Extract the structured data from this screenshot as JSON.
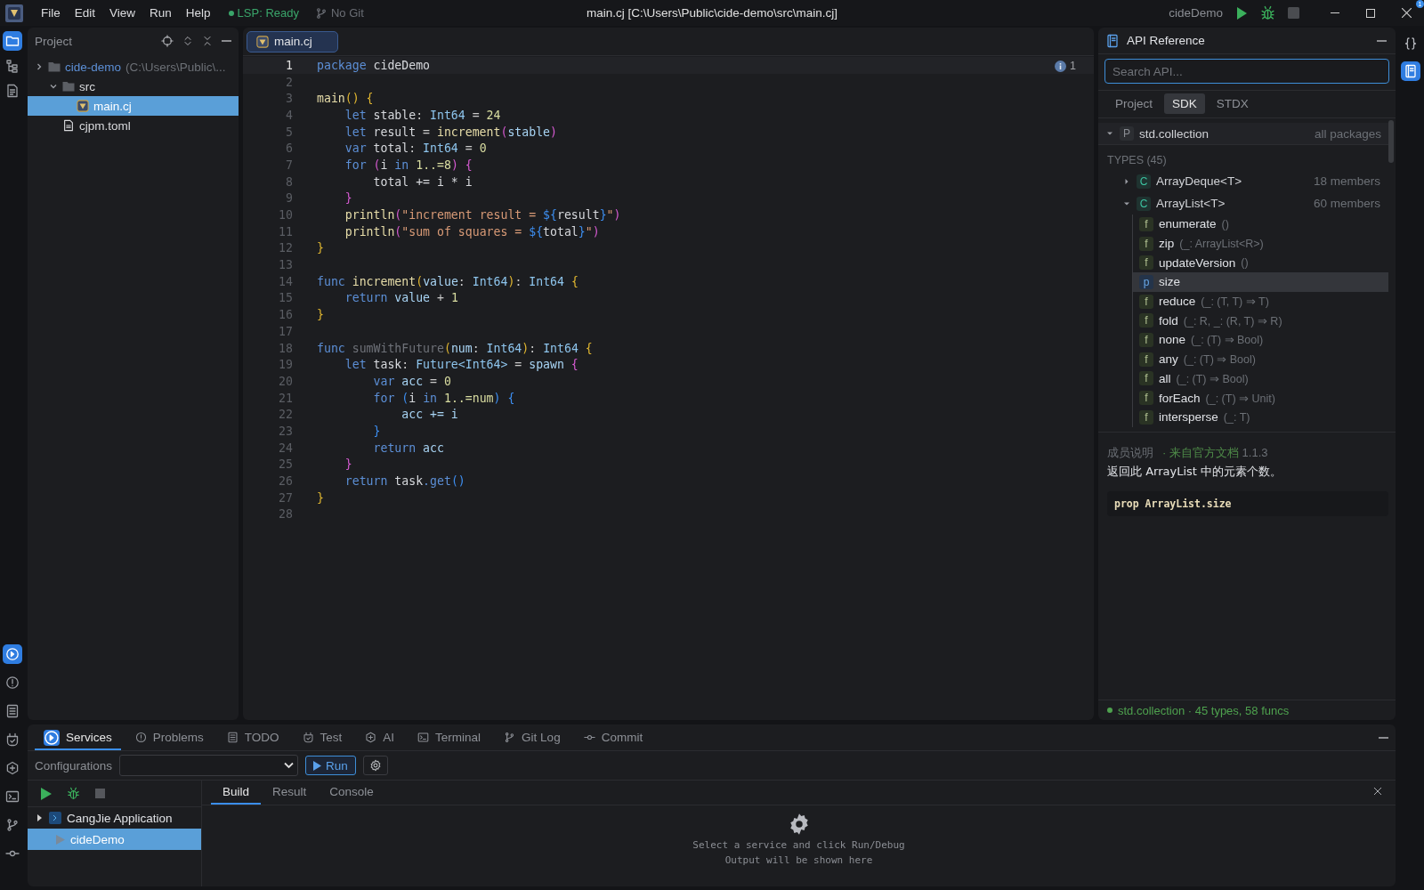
{
  "title_bar": {
    "menu": [
      "File",
      "Edit",
      "View",
      "Run",
      "Help"
    ],
    "lsp_status": "LSP: Ready",
    "git_status": "No Git",
    "title": "main.cj [C:\\Users\\Public\\cide-demo\\src\\main.cj]",
    "run_config": "cideDemo",
    "notification_badge": "1"
  },
  "activity_bar": {
    "top": [
      {
        "kind": "folder",
        "selected": true
      },
      {
        "kind": "structure",
        "selected": false
      },
      {
        "kind": "document",
        "selected": false
      }
    ],
    "bottom": [
      {
        "kind": "services",
        "selected": true
      },
      {
        "kind": "problems",
        "selected": false
      },
      {
        "kind": "todo",
        "selected": false
      },
      {
        "kind": "test",
        "selected": false
      },
      {
        "kind": "ai",
        "selected": false
      },
      {
        "kind": "terminal",
        "selected": false
      },
      {
        "kind": "git",
        "selected": false
      },
      {
        "kind": "commit",
        "selected": false
      }
    ]
  },
  "project": {
    "title": "Project",
    "tree": [
      {
        "name": "cide-demo",
        "path": "(C:\\Users\\Public\\...",
        "kind": "folder",
        "expanded": false,
        "selected": false,
        "children": [
          {
            "name": "src",
            "kind": "folder",
            "expanded": true,
            "selected": false,
            "children": [
              {
                "name": "main.cj",
                "kind": "cj",
                "selected": true
              }
            ]
          },
          {
            "name": "cjpm.toml",
            "kind": "file",
            "selected": false
          }
        ]
      }
    ]
  },
  "editor": {
    "tabs": [
      {
        "label": "main.cj",
        "selected": true
      }
    ],
    "info_count": "1",
    "lines": [
      {
        "number": "1",
        "current": true,
        "tokens": [
          {
            "text": "package",
            "kind": "kw"
          },
          {
            "text": " cideDemo",
            "kind": "id"
          }
        ]
      },
      {
        "number": "2",
        "current": false
      },
      {
        "number": "3",
        "current": false,
        "tokens": [
          {
            "text": "main",
            "kind": "fn"
          },
          {
            "text": "()",
            "kind": "b1"
          },
          {
            "text": " {",
            "kind": "b1"
          }
        ]
      },
      {
        "number": "4",
        "current": false,
        "tokens": [
          {
            "text": "    let",
            "kind": "kw"
          },
          {
            "text": " stable",
            "kind": "id"
          },
          {
            "text": ": ",
            "kind": "op"
          },
          {
            "text": "Int64",
            "kind": "type"
          },
          {
            "text": " = ",
            "kind": "op"
          },
          {
            "text": "24",
            "kind": "num"
          }
        ]
      },
      {
        "number": "5",
        "current": false,
        "tokens": [
          {
            "text": "    let",
            "kind": "kw"
          },
          {
            "text": " result",
            "kind": "id"
          },
          {
            "text": " = ",
            "kind": "op"
          },
          {
            "text": "increment",
            "kind": "fn"
          },
          {
            "text": "(",
            "kind": "b2"
          },
          {
            "text": "stable",
            "kind": "param"
          },
          {
            "text": ")",
            "kind": "b2"
          }
        ]
      },
      {
        "number": "6",
        "current": false,
        "tokens": [
          {
            "text": "    var",
            "kind": "kw"
          },
          {
            "text": " total",
            "kind": "id"
          },
          {
            "text": ": ",
            "kind": "op"
          },
          {
            "text": "Int64",
            "kind": "type"
          },
          {
            "text": " = ",
            "kind": "op"
          },
          {
            "text": "0",
            "kind": "num"
          }
        ]
      },
      {
        "number": "7",
        "current": false,
        "tokens": [
          {
            "text": "    for",
            "kind": "kw"
          },
          {
            "text": " (",
            "kind": "b2"
          },
          {
            "text": "i",
            "kind": "id"
          },
          {
            "text": " in ",
            "kind": "kw"
          },
          {
            "text": "1..=8",
            "kind": "num"
          },
          {
            "text": ")",
            "kind": "b2"
          },
          {
            "text": " {",
            "kind": "b2"
          }
        ]
      },
      {
        "number": "8",
        "current": false,
        "tokens": [
          {
            "text": "        total += i * i",
            "kind": "id"
          }
        ]
      },
      {
        "number": "9",
        "current": false,
        "tokens": [
          {
            "text": "    }",
            "kind": "b2"
          }
        ]
      },
      {
        "number": "10",
        "current": false,
        "tokens": [
          {
            "text": "    println",
            "kind": "fn"
          },
          {
            "text": "(",
            "kind": "b2"
          },
          {
            "text": "\"increment result = ",
            "kind": "str"
          },
          {
            "text": "${",
            "kind": "b3"
          },
          {
            "text": "result",
            "kind": "id"
          },
          {
            "text": "}",
            "kind": "b3"
          },
          {
            "text": "\"",
            "kind": "str"
          },
          {
            "text": ")",
            "kind": "b2"
          }
        ]
      },
      {
        "number": "11",
        "current": false,
        "tokens": [
          {
            "text": "    println",
            "kind": "fn"
          },
          {
            "text": "(",
            "kind": "b2"
          },
          {
            "text": "\"sum of squares = ",
            "kind": "str"
          },
          {
            "text": "${",
            "kind": "b3"
          },
          {
            "text": "total",
            "kind": "id"
          },
          {
            "text": "}",
            "kind": "b3"
          },
          {
            "text": "\"",
            "kind": "str"
          },
          {
            "text": ")",
            "kind": "b2"
          }
        ]
      },
      {
        "number": "12",
        "current": false,
        "tokens": [
          {
            "text": "}",
            "kind": "b1"
          }
        ]
      },
      {
        "number": "13",
        "current": false
      },
      {
        "number": "14",
        "current": false,
        "tokens": [
          {
            "text": "func",
            "kind": "kw"
          },
          {
            "text": " increment",
            "kind": "fn"
          },
          {
            "text": "(",
            "kind": "b1"
          },
          {
            "text": "value",
            "kind": "param"
          },
          {
            "text": ": ",
            "kind": "op"
          },
          {
            "text": "Int64",
            "kind": "type"
          },
          {
            "text": ")",
            "kind": "b1"
          },
          {
            "text": ": ",
            "kind": "op"
          },
          {
            "text": "Int64",
            "kind": "type"
          },
          {
            "text": " {",
            "kind": "b1"
          }
        ]
      },
      {
        "number": "15",
        "current": false,
        "tokens": [
          {
            "text": "    return",
            "kind": "kw"
          },
          {
            "text": " value",
            "kind": "param"
          },
          {
            "text": " + ",
            "kind": "op"
          },
          {
            "text": "1",
            "kind": "num"
          }
        ]
      },
      {
        "number": "16",
        "current": false,
        "tokens": [
          {
            "text": "}",
            "kind": "b1"
          }
        ]
      },
      {
        "number": "17",
        "current": false
      },
      {
        "number": "18",
        "current": false,
        "tokens": [
          {
            "text": "func",
            "kind": "kw"
          },
          {
            "text": " sumWithFuture",
            "kind": "dim"
          },
          {
            "text": "(",
            "kind": "b1"
          },
          {
            "text": "num",
            "kind": "param"
          },
          {
            "text": ": ",
            "kind": "op"
          },
          {
            "text": "Int64",
            "kind": "type"
          },
          {
            "text": ")",
            "kind": "b1"
          },
          {
            "text": ": ",
            "kind": "op"
          },
          {
            "text": "Int64",
            "kind": "type"
          },
          {
            "text": " {",
            "kind": "b1"
          }
        ]
      },
      {
        "number": "19",
        "current": false,
        "tokens": [
          {
            "text": "    let",
            "kind": "kw"
          },
          {
            "text": " task",
            "kind": "id"
          },
          {
            "text": ": ",
            "kind": "op"
          },
          {
            "text": "Future<Int64>",
            "kind": "type"
          },
          {
            "text": " = ",
            "kind": "op"
          },
          {
            "text": "spawn",
            "kind": "param"
          },
          {
            "text": " {",
            "kind": "b2"
          }
        ]
      },
      {
        "number": "20",
        "current": false,
        "tokens": [
          {
            "text": "        var",
            "kind": "kw"
          },
          {
            "text": " acc",
            "kind": "param"
          },
          {
            "text": " = ",
            "kind": "op"
          },
          {
            "text": "0",
            "kind": "num"
          }
        ]
      },
      {
        "number": "21",
        "current": false,
        "tokens": [
          {
            "text": "        for",
            "kind": "kw"
          },
          {
            "text": " (",
            "kind": "b3"
          },
          {
            "text": "i",
            "kind": "id"
          },
          {
            "text": " in ",
            "kind": "kw"
          },
          {
            "text": "1..=num",
            "kind": "num"
          },
          {
            "text": ")",
            "kind": "b3"
          },
          {
            "text": " {",
            "kind": "b3"
          }
        ]
      },
      {
        "number": "22",
        "current": false,
        "tokens": [
          {
            "text": "            acc += i",
            "kind": "param"
          }
        ]
      },
      {
        "number": "23",
        "current": false,
        "tokens": [
          {
            "text": "        }",
            "kind": "b3"
          }
        ]
      },
      {
        "number": "24",
        "current": false,
        "tokens": [
          {
            "text": "        return",
            "kind": "kw"
          },
          {
            "text": " acc",
            "kind": "param"
          }
        ]
      },
      {
        "number": "25",
        "current": false,
        "tokens": [
          {
            "text": "    }",
            "kind": "b2"
          }
        ]
      },
      {
        "number": "26",
        "current": false,
        "tokens": [
          {
            "text": "    return",
            "kind": "kw"
          },
          {
            "text": " task",
            "kind": "id"
          },
          {
            "text": ".get",
            "kind": "method"
          },
          {
            "text": "()",
            "kind": "b3"
          }
        ]
      },
      {
        "number": "27",
        "current": false,
        "tokens": [
          {
            "text": "}",
            "kind": "b1"
          }
        ]
      },
      {
        "number": "28",
        "current": false
      }
    ]
  },
  "api_reference": {
    "title": "API Reference",
    "search": {
      "placeholder": "Search API..."
    },
    "tabs": [
      {
        "label": "Project",
        "selected": false
      },
      {
        "label": "SDK",
        "selected": true
      },
      {
        "label": "STDX",
        "selected": false
      }
    ],
    "package": {
      "badge": "P",
      "name": "std.collection",
      "scope": "all packages",
      "expanded": true
    },
    "section": "TYPES (45)",
    "types": [
      {
        "badge": "C",
        "name": "ArrayDeque<T>",
        "count": "18 members",
        "expanded": false
      },
      {
        "badge": "C",
        "name": "ArrayList<T>",
        "count": "60 members",
        "expanded": true,
        "members": [
          {
            "badge": "f",
            "name": "enumerate",
            "signature": "()",
            "selected": false
          },
          {
            "badge": "f",
            "name": "zip",
            "signature": "(_: ArrayList<R>)",
            "selected": false
          },
          {
            "badge": "f",
            "name": "updateVersion",
            "signature": "()",
            "selected": false
          },
          {
            "badge": "p",
            "name": "size",
            "selected": true
          },
          {
            "badge": "f",
            "name": "reduce",
            "signature": "(_: (T, T) ⇒ T)",
            "selected": false
          },
          {
            "badge": "f",
            "name": "fold",
            "signature": "(_: R, _: (R, T) ⇒ R)",
            "selected": false
          },
          {
            "badge": "f",
            "name": "none",
            "signature": "(_: (T) ⇒ Bool)",
            "selected": false
          },
          {
            "badge": "f",
            "name": "any",
            "signature": "(_: (T) ⇒ Bool)",
            "selected": false
          },
          {
            "badge": "f",
            "name": "all",
            "signature": "(_: (T) ⇒ Bool)",
            "selected": false
          },
          {
            "badge": "f",
            "name": "forEach",
            "signature": "(_: (T) ⇒ Unit)",
            "selected": false
          },
          {
            "badge": "f",
            "name": "intersperse",
            "signature": "(_: T)",
            "selected": false
          }
        ]
      }
    ],
    "detail": {
      "heading": "成员说明",
      "source": "· 来自官方文档",
      "version": "1.1.3",
      "description": "返回此 ArrayList 中的元素个数。",
      "code": "prop ArrayList.size"
    },
    "status": "std.collection · 45 types, 58 funcs"
  },
  "right_bar": [
    {
      "kind": "braces",
      "selected": false
    },
    {
      "kind": "book",
      "selected": true
    }
  ],
  "bottom_panel": {
    "tabs": [
      {
        "label": "Services",
        "kind": "services",
        "selected": true
      },
      {
        "label": "Problems",
        "kind": "problems",
        "selected": false
      },
      {
        "label": "TODO",
        "kind": "todo",
        "selected": false
      },
      {
        "label": "Test",
        "kind": "test",
        "selected": false
      },
      {
        "label": "AI",
        "kind": "ai",
        "selected": false
      },
      {
        "label": "Terminal",
        "kind": "terminal",
        "selected": false
      },
      {
        "label": "Git Log",
        "kind": "git",
        "selected": false
      },
      {
        "label": "Commit",
        "kind": "commit",
        "selected": false
      }
    ],
    "configurations": {
      "label": "Configurations",
      "run": "Run"
    },
    "output_tabs": [
      {
        "label": "Build",
        "selected": true
      },
      {
        "label": "Result",
        "selected": false
      },
      {
        "label": "Console",
        "selected": false
      }
    ],
    "services": [
      {
        "name": "CangJie Application",
        "expanded": false,
        "selected": false,
        "children": [
          {
            "name": "cideDemo",
            "selected": true
          }
        ]
      }
    ],
    "empty_message": [
      "Select a service and click Run/Debug",
      "Output will be shown here"
    ]
  }
}
